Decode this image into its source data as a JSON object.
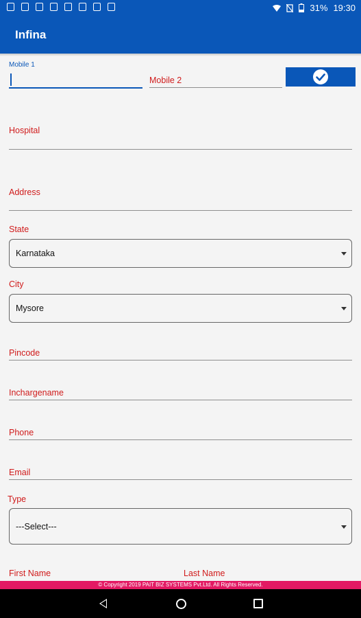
{
  "statusbar": {
    "battery": "31%",
    "time": "19:30"
  },
  "app": {
    "title": "Infina"
  },
  "form": {
    "mobile1": {
      "label": "Mobile 1",
      "value": ""
    },
    "mobile2": {
      "label": "Mobile 2"
    },
    "hospital": {
      "label": "Hospital"
    },
    "address": {
      "label": "Address"
    },
    "state": {
      "label": "State",
      "value": "Karnataka"
    },
    "city": {
      "label": "City",
      "value": "Mysore"
    },
    "pincode": {
      "label": "Pincode"
    },
    "incharge": {
      "label": "Inchargename"
    },
    "phone": {
      "label": "Phone"
    },
    "email": {
      "label": "Email"
    },
    "type": {
      "label": "Type",
      "value": "---Select---"
    },
    "first_name": {
      "label": "First Name"
    },
    "last_name": {
      "label": "Last Name"
    }
  },
  "footer": {
    "copyright": "© Copyright 2019 PAIT BIZ SYSTEMS Pvt.Ltd. All Rights Reserved."
  },
  "colors": {
    "primary": "#0a57b8",
    "label_red": "#d01b1b",
    "footer_pink": "#e31963"
  }
}
